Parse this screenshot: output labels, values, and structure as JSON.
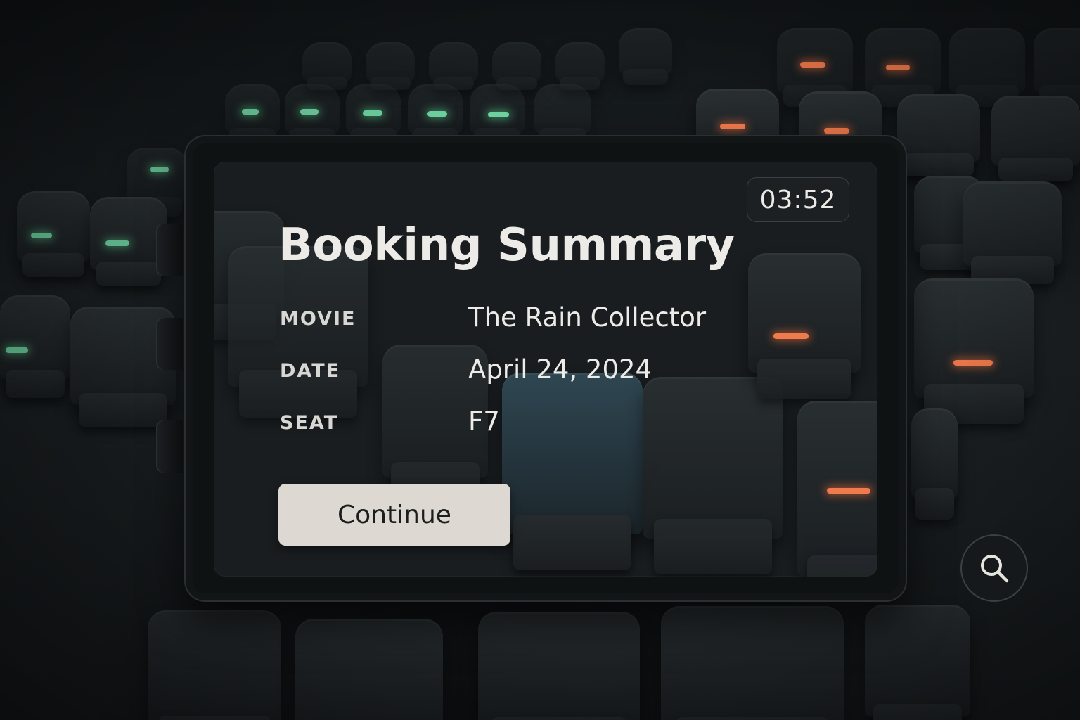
{
  "kiosk": {
    "timer": "03:52",
    "title": "Booking Summary",
    "rows": [
      {
        "label": "MOVIE",
        "value": "The Rain Collector"
      },
      {
        "label": "DATE",
        "value": "April 24, 2024"
      },
      {
        "label": "SEAT",
        "value": "F7"
      }
    ],
    "continue_label": "Continue"
  },
  "icons": {
    "search": "search-icon"
  },
  "colors": {
    "available_seat_light": "#6fd4a2",
    "occupied_seat_light": "#f07a4c",
    "selected_seat": "#2f4752",
    "button_bg": "#ddd9d2"
  }
}
